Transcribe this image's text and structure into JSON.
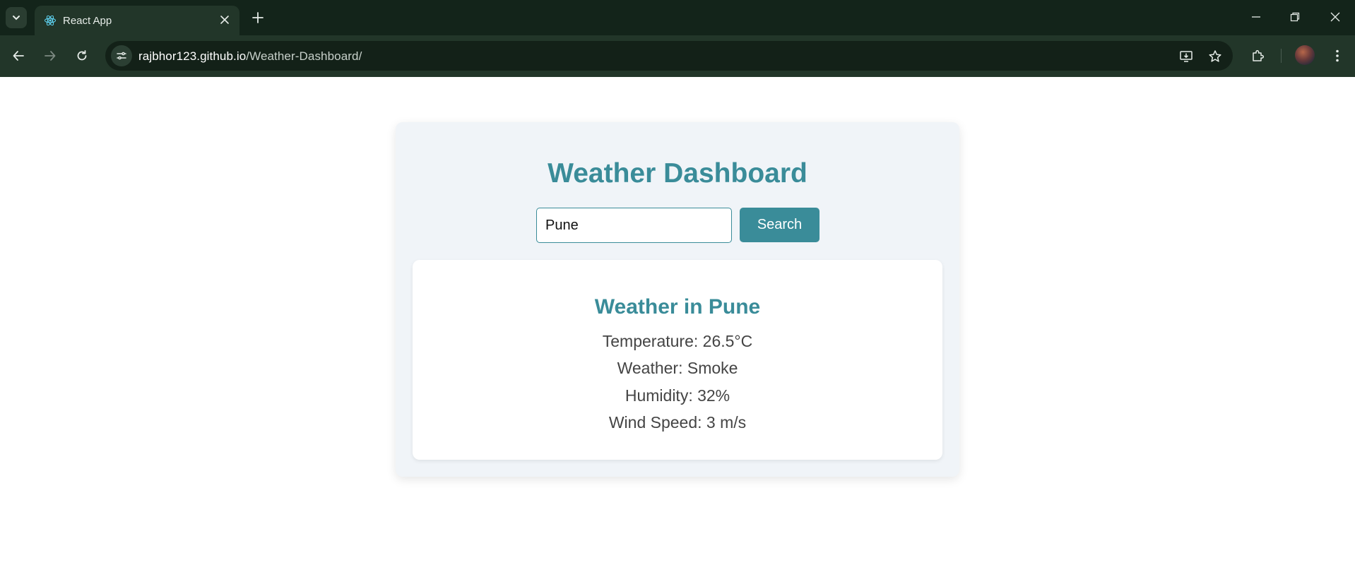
{
  "browser": {
    "tab": {
      "title": "React App",
      "favicon": "react-icon"
    },
    "url": {
      "host": "rajbhor123.github.io",
      "path": "/Weather-Dashboard/"
    },
    "colors": {
      "frame": "#13241a",
      "toolbar": "#223629",
      "omnibox": "#132118"
    }
  },
  "dashboard": {
    "title": "Weather Dashboard",
    "search": {
      "value": "Pune",
      "placeholder": ""
    },
    "search_button": "Search",
    "weather": {
      "heading": "Weather in Pune",
      "temperature": "Temperature: 26.5°C",
      "condition": "Weather: Smoke",
      "humidity": "Humidity: 32%",
      "wind": "Wind Speed: 3 m/s"
    },
    "colors": {
      "accent": "#3a8c99",
      "panel": "#f0f4f8",
      "text": "#444444"
    }
  }
}
